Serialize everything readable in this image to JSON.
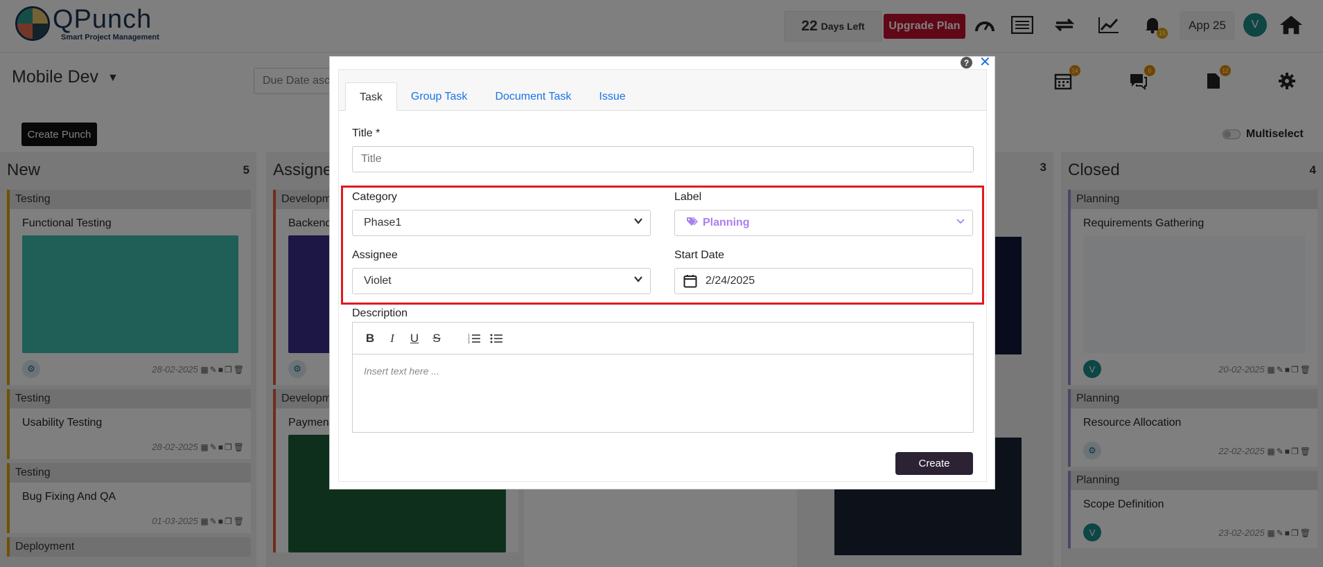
{
  "header": {
    "logo_name": "QPunch",
    "logo_tagline": "Smart Project Management",
    "days_left_number": "22",
    "days_left_label": "Days Left",
    "upgrade_label": "Upgrade Plan",
    "notification_count": "15",
    "app_label": "App 25",
    "user_initial": "V"
  },
  "subheader": {
    "project_name": "Mobile Dev",
    "sort_value": "Due Date asc",
    "badge_1": "14",
    "badge_2": "0",
    "badge_3": "12",
    "create_punch_label": "Create Punch",
    "multiselect_label": "Multiselect"
  },
  "columns": [
    {
      "title": "New",
      "count": "5",
      "cards": [
        {
          "category": "Testing",
          "title": "Functional Testing",
          "date": "28-02-2025"
        },
        {
          "category": "Testing",
          "title": "Usability Testing",
          "date": "28-02-2025"
        },
        {
          "category": "Testing",
          "title": "Bug Fixing And QA",
          "date": "01-03-2025"
        },
        {
          "category": "Deployment",
          "title": "",
          "date": ""
        }
      ]
    },
    {
      "title": "Assigned",
      "count": "",
      "cards": [
        {
          "category": "Development",
          "title": "Backend",
          "date": ""
        },
        {
          "category": "Development",
          "title": "Payment",
          "date": ""
        }
      ]
    },
    {
      "title": "",
      "count": "3",
      "cards": []
    },
    {
      "title": "Closed",
      "count": "4",
      "cards": [
        {
          "category": "Planning",
          "title": "Requirements Gathering",
          "date": "20-02-2025",
          "avatar": "V"
        },
        {
          "category": "Planning",
          "title": "Resource Allocation",
          "date": "22-02-2025"
        },
        {
          "category": "Planning",
          "title": "Scope Definition",
          "date": "23-02-2025",
          "avatar": "V"
        }
      ]
    }
  ],
  "modal": {
    "tabs": [
      "Task",
      "Group Task",
      "Document Task",
      "Issue"
    ],
    "title_label": "Title *",
    "title_placeholder": "Title",
    "category_label": "Category",
    "category_value": "Phase1",
    "label_label": "Label",
    "label_value": "Planning",
    "assignee_label": "Assignee",
    "assignee_value": "Violet",
    "start_date_label": "Start Date",
    "start_date_value": "2/24/2025",
    "description_label": "Description",
    "description_placeholder": "Insert text here ...",
    "create_label": "Create",
    "colors": {
      "label_purple": "#a97ff0",
      "highlight_red": "#e0191e",
      "create_btn": "#2b2233",
      "tab_link": "#1a73e8"
    }
  }
}
